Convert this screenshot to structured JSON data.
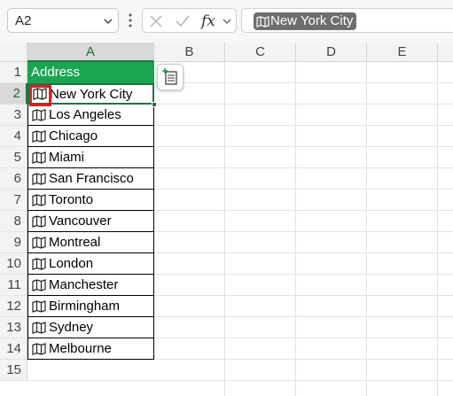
{
  "name_box": {
    "value": "A2"
  },
  "formula_bar": {
    "fx_label": "fx",
    "content": "New York City"
  },
  "columns": [
    "A",
    "B",
    "C",
    "D",
    "E"
  ],
  "rows": [
    "1",
    "2",
    "3",
    "4",
    "5",
    "6",
    "7",
    "8",
    "9",
    "10",
    "11",
    "12",
    "13",
    "14",
    "15"
  ],
  "header_cell": "Address",
  "cities": [
    "New York City",
    "Los Angeles",
    "Chicago",
    "Miami",
    "San Francisco",
    "Toronto",
    "Vancouver",
    "Montreal",
    "London",
    "Manchester",
    "Birmingham",
    "Sydney",
    "Melbourne"
  ],
  "selected_cell": "A2",
  "icons": {
    "data_type": "map-icon",
    "quick_action": "insert-data-icon"
  },
  "colors": {
    "header_fill": "#1aa552",
    "selection": "#217346",
    "highlight": "#e01b24"
  }
}
